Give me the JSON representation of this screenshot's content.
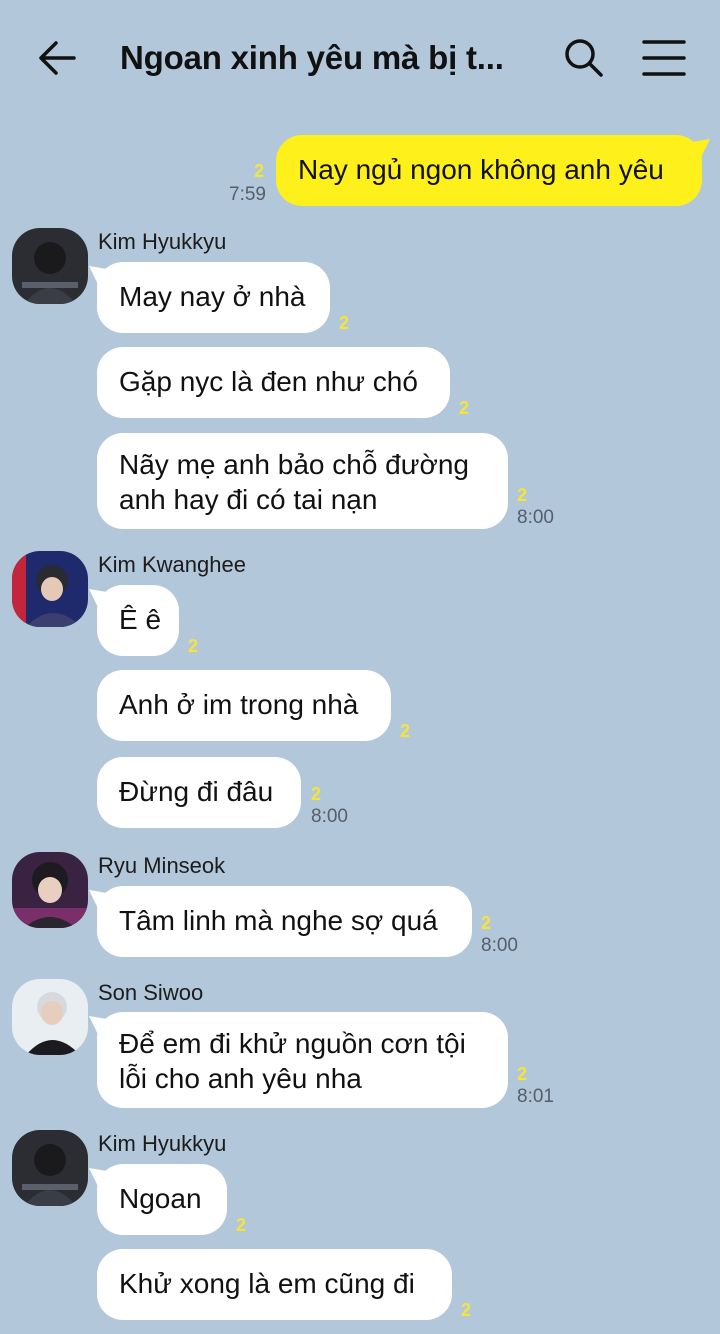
{
  "header": {
    "title": "Ngoan xinh yêu mà bị t...",
    "back_icon": "arrow-left-icon",
    "search_icon": "search-icon",
    "menu_icon": "hamburger-menu-icon"
  },
  "colors": {
    "background": "#b2c7da",
    "outgoing_bubble": "#fef01b",
    "incoming_bubble": "#ffffff",
    "read_count": "#f5e53a"
  },
  "messages": {
    "m0": {
      "text": "Nay ngủ ngon không anh yêu",
      "unread": "2",
      "time": "7:59"
    },
    "g1": {
      "sender": "Kim Hyukkyu",
      "m1": {
        "text": "May nay ở nhà",
        "unread": "2"
      },
      "m2": {
        "text": "Gặp nyc là đen như chó",
        "unread": "2"
      },
      "m3": {
        "line1": "Nãy mẹ anh bảo chỗ đường",
        "line2": "anh hay đi có tai nạn",
        "unread": "2",
        "time": "8:00"
      }
    },
    "g2": {
      "sender": "Kim Kwanghee",
      "m1": {
        "text": "Ê ê",
        "unread": "2"
      },
      "m2": {
        "text": "Anh ở im trong nhà",
        "unread": "2"
      },
      "m3": {
        "text": "Đừng đi đâu",
        "unread": "2",
        "time": "8:00"
      }
    },
    "g3": {
      "sender": "Ryu Minseok",
      "m1": {
        "text": "Tâm linh mà nghe sợ quá",
        "unread": "2",
        "time": "8:00"
      }
    },
    "g4": {
      "sender": "Son Siwoo",
      "m1": {
        "line1": "Để em đi khử nguồn cơn tội",
        "line2": "lỗi cho anh yêu nha",
        "unread": "2",
        "time": "8:01"
      }
    },
    "g5": {
      "sender": "Kim Hyukkyu",
      "m1": {
        "text": "Ngoan",
        "unread": "2"
      },
      "m2": {
        "text": "Khử xong là em cũng đi",
        "unread": "2"
      }
    }
  }
}
